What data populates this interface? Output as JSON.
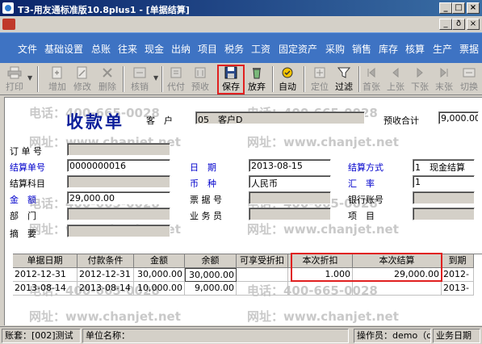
{
  "window": {
    "title": "T3-用友通标准版10.8plus1 - [单据结算]",
    "minimize": "_",
    "maximize": "□",
    "close": "×",
    "sub_minimize": "_",
    "sub_restore": "ð",
    "sub_close": "×"
  },
  "menu": [
    "文件",
    "基础设置",
    "总账",
    "往来",
    "现金",
    "出纳",
    "项目",
    "税务",
    "工资",
    "固定资产",
    "采购",
    "销售",
    "库存",
    "核算",
    "生产",
    "票据"
  ],
  "toolbar": [
    {
      "label": "打印",
      "icon": "printer-icon",
      "enabled": false
    },
    {
      "label": "增加",
      "icon": "add-icon",
      "enabled": false
    },
    {
      "label": "修改",
      "icon": "edit-icon",
      "enabled": false
    },
    {
      "label": "删除",
      "icon": "delete-icon",
      "enabled": false
    },
    {
      "label": "核销",
      "icon": "writeoff-icon",
      "enabled": false
    },
    {
      "label": "代付",
      "icon": "pay-on-behalf-icon",
      "enabled": false
    },
    {
      "label": "预收",
      "icon": "prepay-icon",
      "enabled": false
    },
    {
      "label": "保存",
      "icon": "save-icon",
      "enabled": true
    },
    {
      "label": "放弃",
      "icon": "abandon-icon",
      "enabled": true
    },
    {
      "label": "自动",
      "icon": "auto-icon",
      "enabled": true
    },
    {
      "label": "定位",
      "icon": "locate-icon",
      "enabled": false
    },
    {
      "label": "过滤",
      "icon": "filter-icon",
      "enabled": true
    },
    {
      "label": "首张",
      "icon": "first-icon",
      "enabled": false
    },
    {
      "label": "上张",
      "icon": "prev-icon",
      "enabled": false
    },
    {
      "label": "下张",
      "icon": "next-icon",
      "enabled": false
    },
    {
      "label": "末张",
      "icon": "last-icon",
      "enabled": false
    },
    {
      "label": "切换",
      "icon": "switch-icon",
      "enabled": false
    }
  ],
  "form": {
    "doc_title": "收款单",
    "customer_label": "客　户",
    "customer_value": "05　客户D",
    "prepay_total_label": "预收合计",
    "prepay_total_value": "9,000.00",
    "order_no_label": "订 单 号",
    "order_no_value": "",
    "settle_no_label": "结算单号",
    "settle_no_value": "0000000016",
    "settle_subject_label": "结算科目",
    "settle_subject_value": "",
    "amount_label": "金　额",
    "amount_value": "29,000.00",
    "dept_label": "部　门",
    "dept_value": "",
    "summary_label": "摘　要",
    "summary_value": "",
    "date_label": "日　期",
    "date_value": "2013-08-15",
    "currency_label": "币　种",
    "currency_value": "人民币",
    "bill_no_label": "票 据 号",
    "bill_no_value": "",
    "salesman_label": "业 务 员",
    "salesman_value": "",
    "settle_method_label": "结算方式",
    "settle_method_value": "1　现金结算",
    "rate_label": "汇　率",
    "rate_value": "1",
    "bank_account_label": "银行账号",
    "bank_account_value": "",
    "project_label": "项　目",
    "project_value": ""
  },
  "watermark": {
    "phone": "电话：400-665-0028",
    "site": "网址：www.chanjet.net"
  },
  "grid": {
    "columns": [
      "单据日期",
      "付款条件",
      "金额",
      "余额",
      "可享受折扣",
      "本次折扣",
      "本次结算",
      "到期"
    ],
    "rows": [
      [
        "2012-12-31",
        "2012-12-31",
        "30,000.00",
        "30,000.00",
        "",
        "1.000",
        "29,000.00",
        "2012-"
      ],
      [
        "2013-08-14",
        "2013-08-14",
        "10,000.00",
        "9,000.00",
        "",
        "",
        "",
        "2013-"
      ]
    ]
  },
  "status": {
    "account": "账套：[002]测试",
    "unit": "单位名称：",
    "operator": "操作员：demo（de",
    "business_date": "业务日期"
  }
}
